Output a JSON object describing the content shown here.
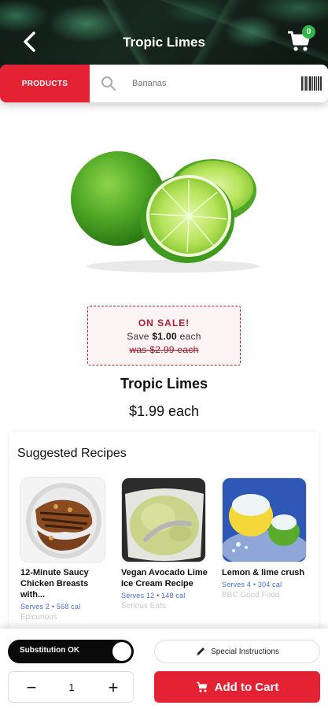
{
  "header": {
    "title": "Tropic Limes",
    "cart_count": "0"
  },
  "search": {
    "products_label": "PRODUCTS",
    "placeholder": "Bananas"
  },
  "sale": {
    "title": "ON SALE!",
    "save_prefix": "Save",
    "save_amount": "$1.00",
    "save_suffix": "each",
    "was_text": "was $2.99 each"
  },
  "product": {
    "name": "Tropic Limes",
    "price": "$1.99 each"
  },
  "recipes": {
    "heading": "Suggested Recipes",
    "items": [
      {
        "title": "12-Minute Saucy Chicken Breasts with...",
        "meta": "Serves 2 • 568 cal",
        "source": "Epicurious"
      },
      {
        "title": "Vegan Avocado Lime Ice Cream Recipe",
        "meta": "Serves 12 • 148 cal",
        "source": "Serious Eats"
      },
      {
        "title": "Lemon & lime crush",
        "meta": "Serves 4 • 304 cal",
        "source": "BBC Good Food"
      }
    ]
  },
  "bottom": {
    "substitution_label": "Substitution OK",
    "special_label": "Special Instructions",
    "quantity": "1",
    "minus": "−",
    "plus": "+",
    "add_label": "Add to Cart"
  },
  "colors": {
    "brand_red": "#e52134",
    "badge_green": "#2fb54a",
    "sale_red": "#b01c2c",
    "meta_blue": "#4a6fc4"
  }
}
